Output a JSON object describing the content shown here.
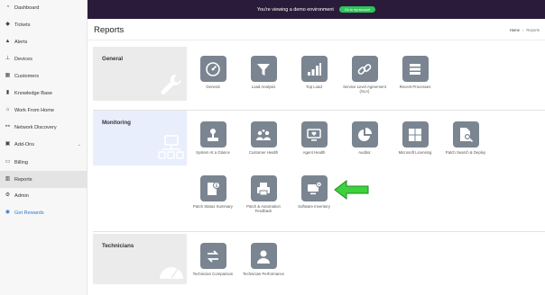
{
  "sidebar": {
    "items": [
      {
        "label": "Dashboard",
        "icon": "dashboard-icon",
        "glyph": "◔"
      },
      {
        "label": "Tickets",
        "icon": "ticket-icon",
        "glyph": "◆"
      },
      {
        "label": "Alerts",
        "icon": "alert-icon",
        "glyph": "▲"
      },
      {
        "label": "Devices",
        "icon": "devices-icon",
        "glyph": "⊥"
      },
      {
        "label": "Customers",
        "icon": "customers-icon",
        "glyph": "▦"
      },
      {
        "label": "Knowledge Base",
        "icon": "book-icon",
        "glyph": "▮"
      },
      {
        "label": "Work From Home",
        "icon": "home-icon",
        "glyph": "⌂"
      },
      {
        "label": "Network Discovery",
        "icon": "network-icon",
        "glyph": "⚯"
      },
      {
        "label": "Add-Ons",
        "icon": "addons-icon",
        "glyph": "▣"
      },
      {
        "label": "Billing",
        "icon": "billing-icon",
        "glyph": "▭"
      },
      {
        "label": "Reports",
        "icon": "reports-icon",
        "glyph": "▥"
      },
      {
        "label": "Admin",
        "icon": "admin-icon",
        "glyph": "⚙"
      },
      {
        "label": "Get Rewards",
        "icon": "rewards-icon",
        "glyph": "◉"
      }
    ],
    "active_color": "#e4e4e4",
    "link_color": "#2a7ad5"
  },
  "banner": {
    "text": "You're viewing a demo environment",
    "button_label": "Go to my account",
    "background": "#2b1b3a",
    "button_color": "#2ec55a"
  },
  "header": {
    "title": "Reports",
    "breadcrumb_home": "Home",
    "breadcrumb_sep": "›",
    "breadcrumb_current": "Reports"
  },
  "sections": {
    "general": {
      "title": "General",
      "tiles": [
        {
          "label": "General",
          "icon": "gauge-icon"
        },
        {
          "label": "Load Analysis",
          "icon": "funnel-icon"
        },
        {
          "label": "Top Load",
          "icon": "bar-chart-icon"
        },
        {
          "label": "Service Level Agreement (SLA)",
          "icon": "link-icon"
        },
        {
          "label": "Recent Processes",
          "icon": "list-icon"
        }
      ]
    },
    "monitoring": {
      "title": "Monitoring",
      "tiles": [
        {
          "label": "System At a Glance",
          "icon": "joystick-icon"
        },
        {
          "label": "Customer Health",
          "icon": "users-heart-icon"
        },
        {
          "label": "Agent Health",
          "icon": "monitor-heart-icon"
        },
        {
          "label": "Auditor",
          "icon": "pie-chart-icon"
        },
        {
          "label": "Microsoft Licensing",
          "icon": "windows-icon"
        },
        {
          "label": "Patch Search & Deploy",
          "icon": "file-search-icon"
        },
        {
          "label": "Patch Status Summary",
          "icon": "file-info-icon"
        },
        {
          "label": "Patch & Automation Feedback",
          "icon": "printer-icon"
        },
        {
          "label": "Software Inventory",
          "icon": "monitor-gear-icon"
        }
      ]
    },
    "technicians": {
      "title": "Technicians",
      "tiles": [
        {
          "label": "Technician Comparison",
          "icon": "swap-icon"
        },
        {
          "label": "Technician Performance",
          "icon": "person-icon"
        }
      ]
    }
  },
  "colors": {
    "tile_icon": "#7a8591",
    "monitoring_bg": "#e8eefc",
    "section_bg": "#ebebeb",
    "arrow": "#3ed13e"
  }
}
